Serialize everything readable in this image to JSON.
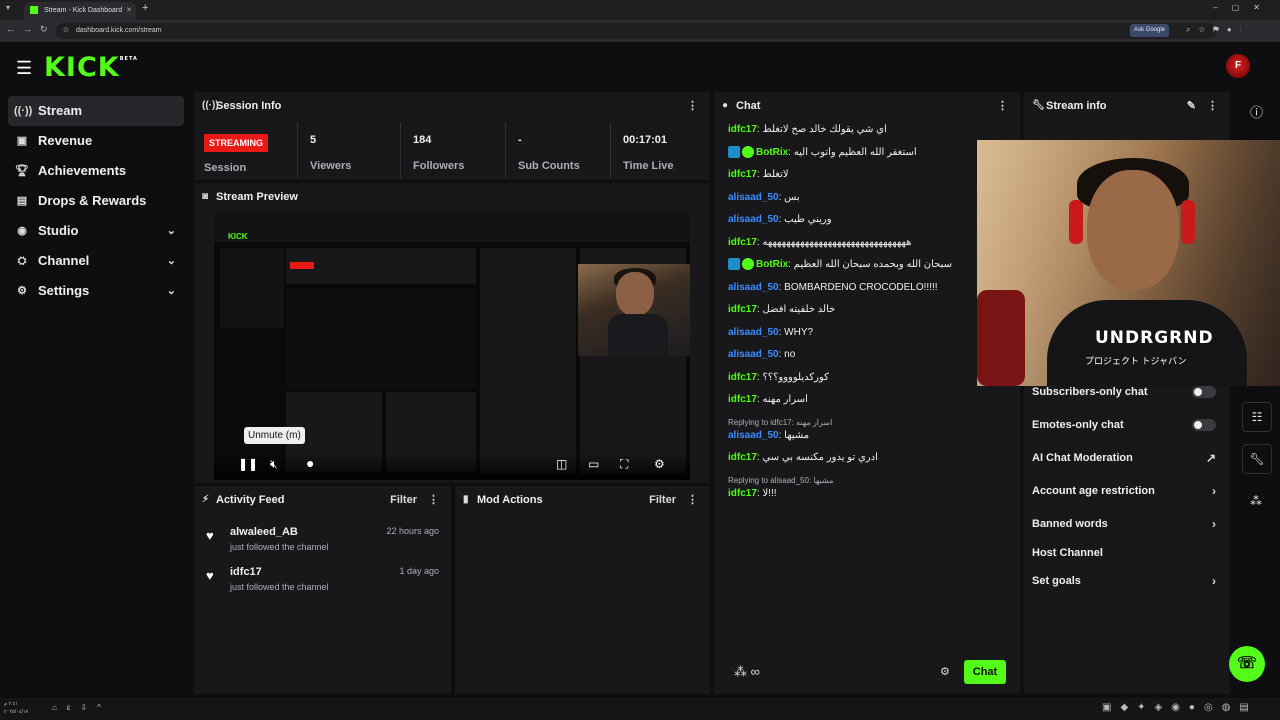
{
  "browser": {
    "tab_title": "Stream - Kick Dashboard",
    "url": "dashboard.kick.com/stream",
    "ask_google": "Ask Google"
  },
  "app": {
    "logo": "KICK",
    "logo_sup": "BETA",
    "avatar_initial": "F"
  },
  "sidebar": {
    "items": [
      {
        "label": "Stream"
      },
      {
        "label": "Revenue"
      },
      {
        "label": "Achievements"
      },
      {
        "label": "Drops & Rewards"
      },
      {
        "label": "Studio"
      },
      {
        "label": "Channel"
      },
      {
        "label": "Settings"
      }
    ]
  },
  "session": {
    "title": "Session Info",
    "badge": "STREAMING",
    "label": "Session",
    "stats": [
      {
        "value": "5",
        "label": "Viewers"
      },
      {
        "value": "184",
        "label": "Followers"
      },
      {
        "value": "-",
        "label": "Sub Counts"
      },
      {
        "value": "00:17:01",
        "label": "Time Live"
      }
    ]
  },
  "preview": {
    "title": "Stream Preview",
    "tooltip": "Unmute (m)"
  },
  "activity": {
    "title": "Activity Feed",
    "filter": "Filter",
    "items": [
      {
        "name": "alwaleed_AB",
        "sub": "just followed the channel",
        "time": "22 hours ago"
      },
      {
        "name": "idfc17",
        "sub": "just followed the channel",
        "time": "1 day ago"
      }
    ]
  },
  "modactions": {
    "title": "Mod Actions",
    "filter": "Filter"
  },
  "chat": {
    "title": "Chat",
    "button": "Chat",
    "messages": [
      {
        "user": "idfc17",
        "color": "#53fc18",
        "text": "اي شي يقولك خالد صح لاتغلط"
      },
      {
        "user": "BotRix",
        "color": "#53fc18",
        "bot": true,
        "text": "استغفر الله العظيم واتوب اليه"
      },
      {
        "user": "idfc17",
        "color": "#53fc18",
        "text": "لاتغلط"
      },
      {
        "user": "alisaad_50",
        "color": "#3d8cff",
        "text": "بس"
      },
      {
        "user": "alisaad_50",
        "color": "#3d8cff",
        "text": "وريني طيب"
      },
      {
        "user": "idfc17",
        "color": "#53fc18",
        "text": "هههههههههههههههههههههههههههههههه"
      },
      {
        "user": "BotRix",
        "color": "#53fc18",
        "bot": true,
        "text": "سبحان الله وبحمده سبحان الله العظيم"
      },
      {
        "user": "alisaad_50",
        "color": "#3d8cff",
        "text": "BOMBARDENO CROCODELO!!!!!"
      },
      {
        "user": "idfc17",
        "color": "#53fc18",
        "text": "خالد خلفيته افضل"
      },
      {
        "user": "alisaad_50",
        "color": "#3d8cff",
        "text": "WHY?"
      },
      {
        "user": "alisaad_50",
        "color": "#3d8cff",
        "text": "no"
      },
      {
        "user": "idfc17",
        "color": "#53fc18",
        "text": "كوركديلوووو؟؟؟"
      },
      {
        "user": "idfc17",
        "color": "#53fc18",
        "text": "اسرار مهنه"
      },
      {
        "reply": "Replying to idfc17: اسرار مهنه",
        "user": "alisaad_50",
        "color": "#3d8cff",
        "text": "مشيها"
      },
      {
        "user": "idfc17",
        "color": "#53fc18",
        "text": "ادري تو يدور مكنسه بي سي"
      },
      {
        "reply": "Replying to alisaad_50: مشيها",
        "user": "idfc17",
        "color": "#53fc18",
        "text": "لا!!!"
      }
    ]
  },
  "streaminfo": {
    "title": "Stream info",
    "items": [
      {
        "label": "Subscribers-only chat",
        "kind": "toggle"
      },
      {
        "label": "Emotes-only chat",
        "kind": "toggle"
      },
      {
        "label": "AI Chat Moderation",
        "kind": "external"
      },
      {
        "label": "Account age restriction",
        "kind": "chevron"
      },
      {
        "label": "Banned words",
        "kind": "chevron"
      },
      {
        "label": "Host Channel",
        "kind": "none"
      },
      {
        "label": "Set goals",
        "kind": "chevron"
      }
    ]
  },
  "webcam": {
    "shirt_logo": "UNDRGRND",
    "shirt_text": "プロジェクト トジャバン"
  },
  "taskbar": {
    "time": "٢:٤١ م",
    "date": "٢٠٢٥/٠٤/١٧"
  }
}
